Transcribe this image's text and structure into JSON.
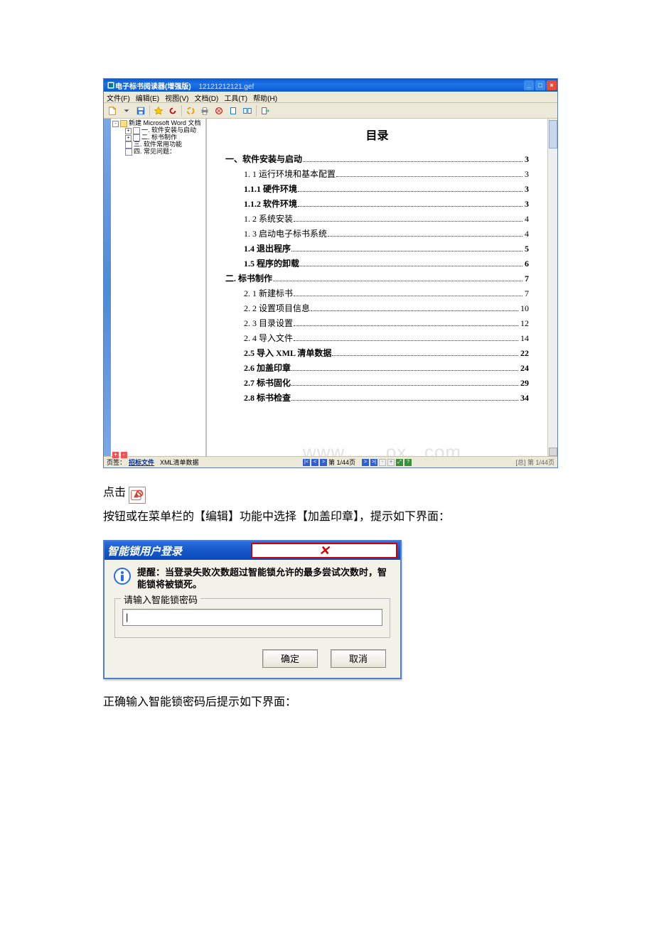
{
  "app": {
    "title": "电子标书阅读器(增强版)",
    "filename": "12121212121.gef",
    "menus": [
      "文件(F)",
      "编辑(E)",
      "视图(V)",
      "文档(D)",
      "工具(T)",
      "帮助(H)"
    ],
    "tree": {
      "root": "新建 Microsoft Word 文档",
      "children": [
        "一. 软件安装与启动",
        "二. 标书制作",
        "三. 软件常用功能",
        "四. 常见问题："
      ]
    },
    "toc_title": "目录",
    "toc": [
      {
        "label": "一、软件安装与启动",
        "page": "3",
        "bold": true
      },
      {
        "label": "1. 1 运行环境和基本配置",
        "page": "3",
        "indent": 1
      },
      {
        "label": "1.1.1 硬件环境",
        "page": "3",
        "bold": true,
        "indent": 1
      },
      {
        "label": "1.1.2 软件环境",
        "page": "3",
        "bold": true,
        "indent": 1
      },
      {
        "label": "1. 2 系统安装",
        "page": "4",
        "indent": 1
      },
      {
        "label": "1. 3 启动电子标书系统",
        "page": "4",
        "indent": 1
      },
      {
        "label": "1.4 退出程序",
        "page": "5",
        "bold": true,
        "indent": 1
      },
      {
        "label": "1.5 程序的卸载",
        "page": "6",
        "bold": true,
        "indent": 1
      },
      {
        "label": "二. 标书制作",
        "page": "7",
        "bold": true
      },
      {
        "label": "2. 1 新建标书",
        "page": "7",
        "indent": 1
      },
      {
        "label": "2. 2 设置项目信息",
        "page": "10",
        "indent": 1
      },
      {
        "label": "2. 3 目录设置",
        "page": "12",
        "indent": 1
      },
      {
        "label": "2. 4 导入文件",
        "page": "14",
        "indent": 1
      },
      {
        "label": "2.5 导入 XML 清单数据",
        "page": "22",
        "bold": true,
        "indent": 1
      },
      {
        "label": "2.6 加盖印章",
        "page": "24",
        "bold": true,
        "indent": 1
      },
      {
        "label": "2.7 标书固化",
        "page": "29",
        "bold": true,
        "indent": 1
      },
      {
        "label": "2.8 标书检查",
        "page": "34",
        "bold": true,
        "indent": 1
      }
    ],
    "status": {
      "label": "页签：",
      "link1": "招标文件",
      "text": "XML清单数据",
      "mid_page": "第 1/44页",
      "right": "[总] 第 1/44页"
    }
  },
  "body": {
    "click_label": "点击",
    "button_sentence": "按钮或在菜单栏的【编辑】功能中选择【加盖印章】，提示如下界面：",
    "after_login": "正确输入智能锁密码后提示如下界面："
  },
  "login": {
    "title": "智能锁用户登录",
    "warning": "提醒：当登录失败次数超过智能锁允许的最多尝试次数时，智能锁将被锁死。",
    "legend": "请输入智能锁密码",
    "placeholder": "|",
    "ok": "确定",
    "cancel": "取消"
  }
}
